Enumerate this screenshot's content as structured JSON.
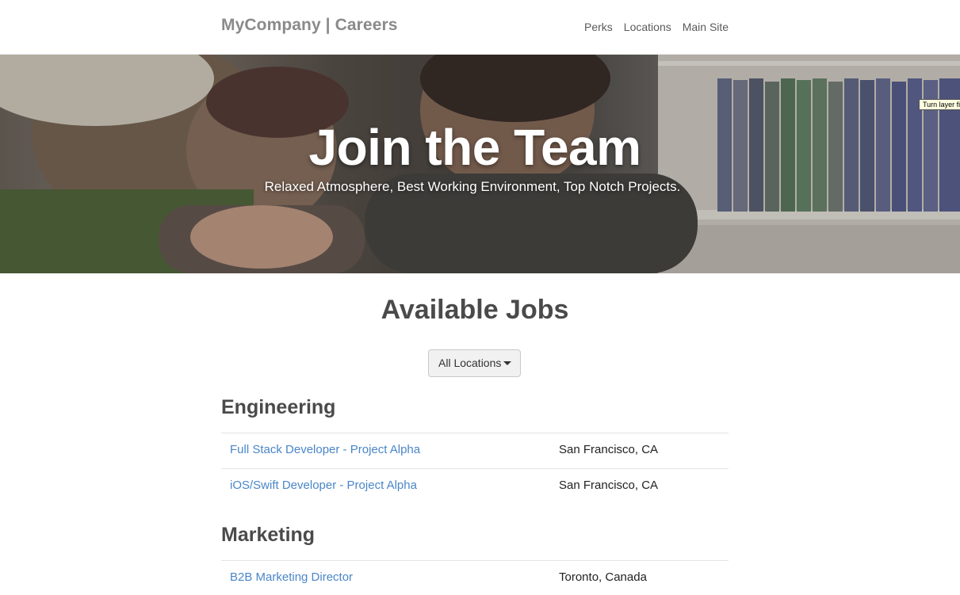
{
  "navbar": {
    "brand": "MyCompany | Careers",
    "links": [
      "Perks",
      "Locations",
      "Main Site"
    ]
  },
  "hero": {
    "title": "Join the Team",
    "subtitle": "Relaxed Atmosphere, Best Working Environment, Top Notch Projects.",
    "tooltip": "Turn layer fi"
  },
  "main": {
    "title": "Available Jobs",
    "location_filter": "All Locations",
    "departments": [
      {
        "name": "Engineering",
        "jobs": [
          {
            "title": "Full Stack Developer - Project Alpha",
            "location": "San Francisco, CA"
          },
          {
            "title": "iOS/Swift Developer - Project Alpha",
            "location": "San Francisco, CA"
          }
        ]
      },
      {
        "name": "Marketing",
        "jobs": [
          {
            "title": "B2B Marketing Director",
            "location": "Toronto, Canada"
          }
        ]
      }
    ]
  },
  "colors": {
    "link": "#4a86c8",
    "brand": "#8a8a8a",
    "heading": "#4a4a4a"
  }
}
